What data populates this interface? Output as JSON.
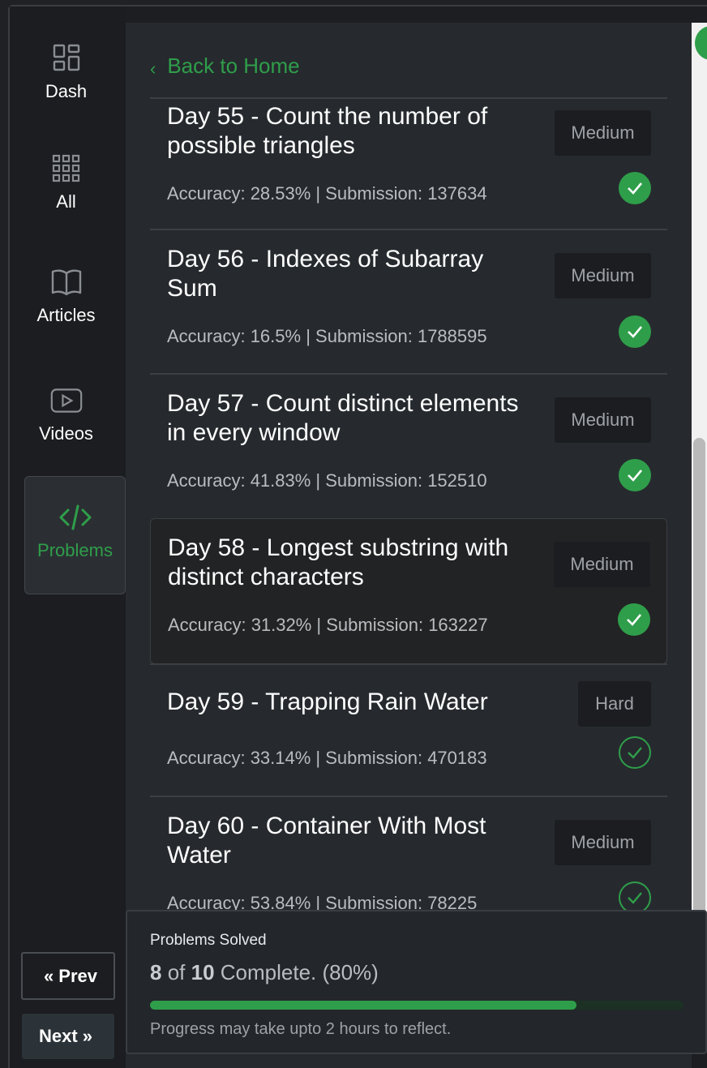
{
  "sidebar": {
    "items": [
      {
        "label": "Dash",
        "icon": "dashboard-icon"
      },
      {
        "label": "All",
        "icon": "grid-icon"
      },
      {
        "label": "Articles",
        "icon": "book-icon"
      },
      {
        "label": "Videos",
        "icon": "play-icon"
      },
      {
        "label": "Problems",
        "icon": "code-icon",
        "active": true
      }
    ],
    "prev_label": "Prev",
    "next_label": "Next"
  },
  "header": {
    "back_label": "Back to Home"
  },
  "problems": [
    {
      "title": "Day 55 - Count the number of possible triangles",
      "difficulty": "Medium",
      "stats": "Accuracy: 28.53% | Submission: 137634",
      "solved": true
    },
    {
      "title": "Day 56 - Indexes of Subarray Sum",
      "difficulty": "Medium",
      "stats": "Accuracy: 16.5% | Submission: 1788595",
      "solved": true
    },
    {
      "title": "Day 57 - Count distinct elements in every window",
      "difficulty": "Medium",
      "stats": "Accuracy: 41.83% | Submission: 152510",
      "solved": true
    },
    {
      "title": "Day 58 - Longest substring with distinct characters",
      "difficulty": "Medium",
      "stats": "Accuracy: 31.32% | Submission: 163227",
      "solved": true,
      "highlighted": true
    },
    {
      "title": "Day 59 - Trapping Rain Water",
      "difficulty": "Hard",
      "stats": "Accuracy: 33.14% | Submission: 470183",
      "solved": false
    },
    {
      "title": "Day 60 - Container With Most Water",
      "difficulty": "Medium",
      "stats": "Accuracy: 53.84% | Submission: 78225",
      "solved": false
    }
  ],
  "progress": {
    "title": "Problems Solved",
    "solved": "8",
    "of_text": " of ",
    "total": "10",
    "suffix": " Complete. (80%)",
    "fraction": 0.8,
    "note": "Progress may take upto 2 hours to reflect."
  },
  "colors": {
    "accent": "#2f9e4a",
    "panel": "#262a2e",
    "sidebar": "#1b1d20"
  }
}
